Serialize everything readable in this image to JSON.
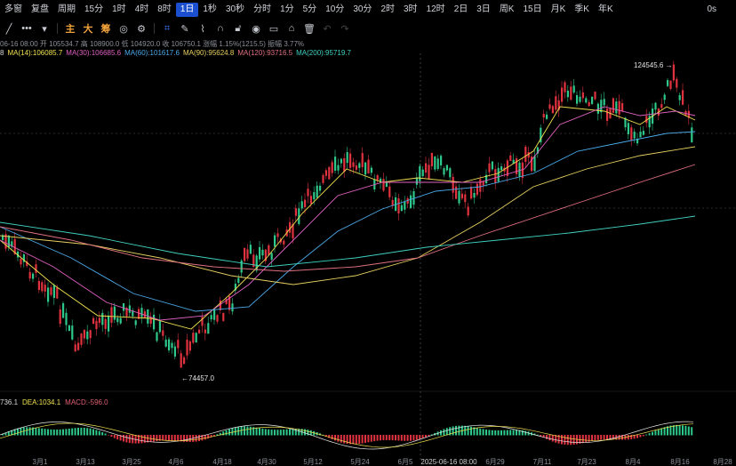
{
  "toolbar": {
    "items": [
      "多窗",
      "复盘",
      "周期",
      "15分",
      "1时",
      "4时",
      "8时",
      "1日",
      "1秒",
      "30秒",
      "分时",
      "1分",
      "5分",
      "10分",
      "30分",
      "2时",
      "3时",
      "12时",
      "2日",
      "3日",
      "周K",
      "15日",
      "月K",
      "季K",
      "年K"
    ],
    "active_index": 7,
    "right_label": "0s"
  },
  "toolbar2": {
    "main_label": "主",
    "sub_label": "大",
    "chou_label": "筹"
  },
  "info_line": "06-16 08:00  开 105534.7  高 108900.0  低 104920.0  收 106750.1  涨幅 1.15%(1215.5)  振幅 3.77%",
  "ma_line": [
    {
      "text": "8",
      "color": "#d8d8d8"
    },
    {
      "text": "MA(14):106085.7",
      "color": "#f0e050"
    },
    {
      "text": "MA(30):106685.6",
      "color": "#e060c0"
    },
    {
      "text": "MA(60):101617.6",
      "color": "#4aa8e8"
    },
    {
      "text": "MA(90):95624.8",
      "color": "#e8d060"
    },
    {
      "text": "MA(120):93716.5",
      "color": "#e07080"
    },
    {
      "text": "MA(200):95719.7",
      "color": "#40d0c0"
    }
  ],
  "macd_line": [
    {
      "text": "736.1",
      "color": "#d8d8d8"
    },
    {
      "text": "DEA:1034.1",
      "color": "#f0e050"
    },
    {
      "text": "MACD:-596.0",
      "color": "#e06070"
    }
  ],
  "annotations": {
    "high": "124545.6 →",
    "low": "←74457.0"
  },
  "x_labels": [
    "3月1",
    "3月13",
    "3月25",
    "4月6",
    "4月18",
    "4月30",
    "5月12",
    "5月24",
    "6月5",
    "2025-06-16 08:00",
    "6月29",
    "7月11",
    "7月23",
    "8月4",
    "8月16",
    "8月28"
  ],
  "colors": {
    "up": "#2ec98a",
    "down": "#e0323f",
    "background": "#000000",
    "accent": "#1c4fd0"
  }
}
